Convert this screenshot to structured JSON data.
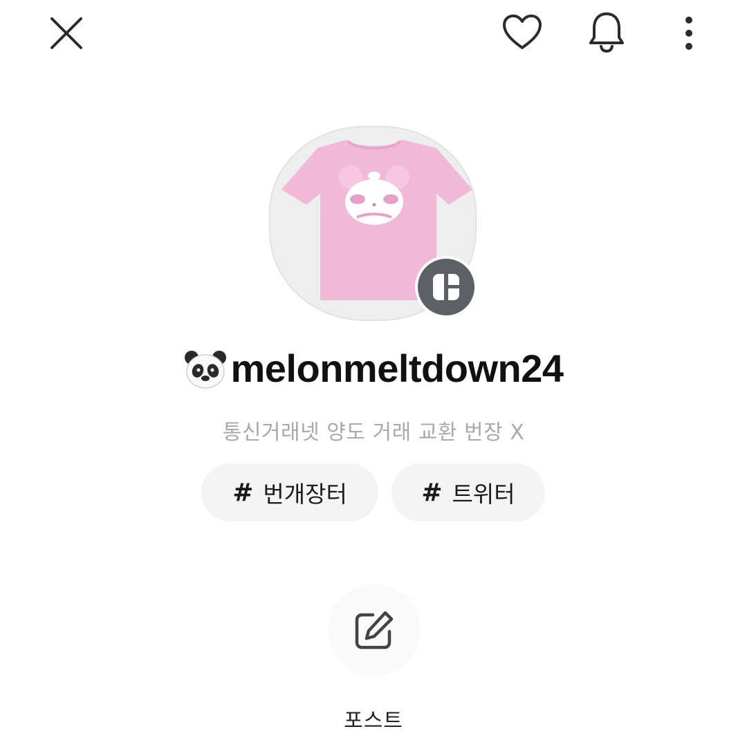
{
  "topbar": {
    "close_icon": "close-icon",
    "heart_icon": "heart-icon",
    "bell_icon": "bell-icon",
    "more_icon": "more-vertical-icon"
  },
  "profile": {
    "username_emoji": "🐼",
    "username": "melonmeltdown24",
    "bio": "통신거래넷 양도 거래 교환 번장 X",
    "avatar": "pink-tshirt-panda-image",
    "badge_icon": "layout-grid-icon"
  },
  "tags": [
    {
      "hash": "#",
      "label": "번개장터"
    },
    {
      "hash": "#",
      "label": "트위터"
    }
  ],
  "post": {
    "icon": "edit-icon",
    "label": "포스트"
  },
  "colors": {
    "tshirt": "#f1b9d7",
    "badge": "#5d6166",
    "bio_text": "#a9a9a9",
    "chip_bg": "#f4f4f4"
  }
}
